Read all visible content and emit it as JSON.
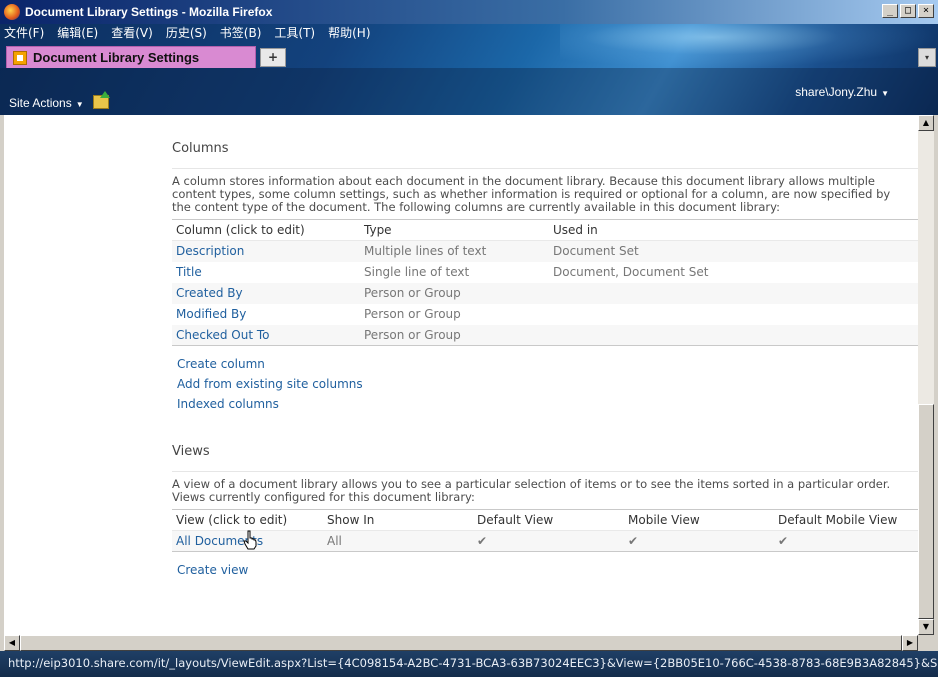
{
  "window": {
    "title": "Document Library Settings - Mozilla Firefox",
    "controls": [
      "_",
      "□",
      "×"
    ]
  },
  "menubar": [
    "文件(F)",
    "编辑(E)",
    "查看(V)",
    "历史(S)",
    "书签(B)",
    "工具(T)",
    "帮助(H)"
  ],
  "tabs": [
    {
      "label": "Document Library Settings",
      "active": true
    }
  ],
  "new_tab_label": "+",
  "tab_list_label": "▾",
  "sharepoint": {
    "site_actions": "Site Actions",
    "user": "share\\Jony.Zhu"
  },
  "columns_section": {
    "heading": "Columns",
    "description": "A column stores information about each document in the document library. Because this document library allows multiple content types, some column settings, such as whether information is required or optional for a column, are now specified by the content type of the document. The following columns are currently available in this document library:",
    "headers": [
      "Column (click to edit)",
      "Type",
      "Used in"
    ],
    "rows": [
      {
        "name": "Description",
        "type": "Multiple lines of text",
        "used_in": "Document Set"
      },
      {
        "name": "Title",
        "type": "Single line of text",
        "used_in": "Document, Document Set"
      },
      {
        "name": "Created By",
        "type": "Person or Group",
        "used_in": ""
      },
      {
        "name": "Modified By",
        "type": "Person or Group",
        "used_in": ""
      },
      {
        "name": "Checked Out To",
        "type": "Person or Group",
        "used_in": ""
      }
    ],
    "links": [
      "Create column",
      "Add from existing site columns",
      "Indexed columns"
    ]
  },
  "views_section": {
    "heading": "Views",
    "description": "A view of a document library allows you to see a particular selection of items or to see the items sorted in a particular order. Views currently configured for this document library:",
    "headers": [
      "View (click to edit)",
      "Show In",
      "Default View",
      "Mobile View",
      "Default Mobile View"
    ],
    "rows": [
      {
        "name": "All Documents",
        "show_in": "All",
        "default_view": "✔",
        "mobile_view": "✔",
        "default_mobile_view": "✔"
      }
    ],
    "links": [
      "Create view"
    ]
  },
  "status_bar": "http://eip3010.share.com/it/_layouts/ViewEdit.aspx?List={4C098154-A2BC-4731-BCA3-63B73024EEC3}&View={2BB05E10-766C-4538-8783-68E9B3A82845}&S..."
}
